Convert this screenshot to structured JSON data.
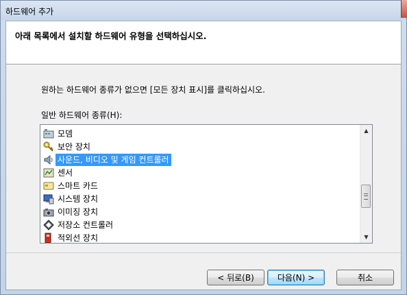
{
  "window": {
    "title": "하드웨어 추가"
  },
  "header": {
    "heading": "아래 목록에서 설치할 하드웨어 유형을 선택하십시오."
  },
  "description": "원하는 하드웨어 종류가 없으면 [모든 장치 표시]를 클릭하십시오.",
  "list": {
    "label": "일반 하드웨어 종류(H):",
    "items": [
      {
        "label": "모뎀",
        "icon": "modem-icon",
        "selected": false
      },
      {
        "label": "보안 장치",
        "icon": "key-icon",
        "selected": false
      },
      {
        "label": "사운드, 비디오 및 게임 컨트롤러",
        "icon": "speaker-icon",
        "selected": true
      },
      {
        "label": "센서",
        "icon": "sensor-icon",
        "selected": false
      },
      {
        "label": "스마트 카드",
        "icon": "smart-card-icon",
        "selected": false
      },
      {
        "label": "시스템 장치",
        "icon": "system-device-icon",
        "selected": false
      },
      {
        "label": "이미징 장치",
        "icon": "imaging-device-icon",
        "selected": false
      },
      {
        "label": "저장소 컨트롤러",
        "icon": "storage-controller-icon",
        "selected": false
      },
      {
        "label": "적외선 장치",
        "icon": "infrared-device-icon",
        "selected": false
      }
    ],
    "scroll_up": "▲",
    "scroll_down": "▼"
  },
  "buttons": {
    "back": "< 뒤로(B)",
    "next": "다음(N) >",
    "cancel": "취소"
  },
  "colors": {
    "selection": "#3399ff",
    "header_bg": "#ffffff",
    "client_bg": "#f0f0f0"
  }
}
